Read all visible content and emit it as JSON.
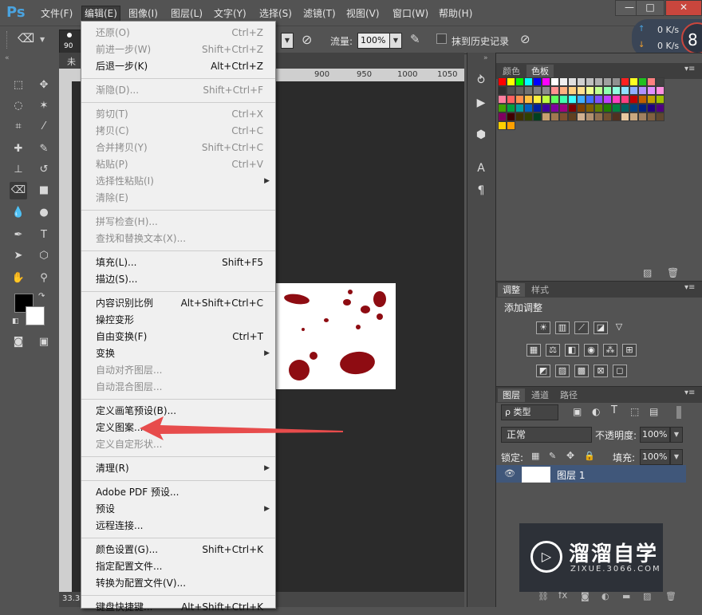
{
  "menubar": {
    "logo": "Ps",
    "items": [
      "文件(F)",
      "编辑(E)",
      "图像(I)",
      "图层(L)",
      "文字(Y)",
      "选择(S)",
      "滤镜(T)",
      "视图(V)",
      "窗口(W)",
      "帮助(H)"
    ],
    "window_buttons": [
      "—",
      "□",
      "✕"
    ]
  },
  "options": {
    "brush_size": "90",
    "flow_label": "流量:",
    "flow_value": "100%",
    "erase_history_label": "抹到历史记录"
  },
  "net": {
    "up": "0 K/s",
    "down": "0 K/s",
    "badge": "8"
  },
  "document": {
    "tab_label": "未",
    "ruler_ticks": [
      "900",
      "950",
      "1000",
      "1050"
    ],
    "zoom": "33.3"
  },
  "edit_menu": {
    "groups": [
      [
        {
          "label": "还原(O)",
          "shortcut": "Ctrl+Z",
          "disabled": true
        },
        {
          "label": "前进一步(W)",
          "shortcut": "Shift+Ctrl+Z",
          "disabled": true
        },
        {
          "label": "后退一步(K)",
          "shortcut": "Alt+Ctrl+Z",
          "disabled": false
        }
      ],
      [
        {
          "label": "渐隐(D)...",
          "shortcut": "Shift+Ctrl+F",
          "disabled": true
        }
      ],
      [
        {
          "label": "剪切(T)",
          "shortcut": "Ctrl+X",
          "disabled": true
        },
        {
          "label": "拷贝(C)",
          "shortcut": "Ctrl+C",
          "disabled": true
        },
        {
          "label": "合并拷贝(Y)",
          "shortcut": "Shift+Ctrl+C",
          "disabled": true
        },
        {
          "label": "粘贴(P)",
          "shortcut": "Ctrl+V",
          "disabled": true
        },
        {
          "label": "选择性粘贴(I)",
          "shortcut": "",
          "disabled": true,
          "submenu": true
        },
        {
          "label": "清除(E)",
          "shortcut": "",
          "disabled": true
        }
      ],
      [
        {
          "label": "拼写检查(H)...",
          "shortcut": "",
          "disabled": true
        },
        {
          "label": "查找和替换文本(X)...",
          "shortcut": "",
          "disabled": true
        }
      ],
      [
        {
          "label": "填充(L)...",
          "shortcut": "Shift+F5",
          "disabled": false
        },
        {
          "label": "描边(S)...",
          "shortcut": "",
          "disabled": false
        }
      ],
      [
        {
          "label": "内容识别比例",
          "shortcut": "Alt+Shift+Ctrl+C",
          "disabled": false
        },
        {
          "label": "操控变形",
          "shortcut": "",
          "disabled": false
        },
        {
          "label": "自由变换(F)",
          "shortcut": "Ctrl+T",
          "disabled": false
        },
        {
          "label": "变换",
          "shortcut": "",
          "disabled": false,
          "submenu": true
        },
        {
          "label": "自动对齐图层...",
          "shortcut": "",
          "disabled": true
        },
        {
          "label": "自动混合图层...",
          "shortcut": "",
          "disabled": true
        }
      ],
      [
        {
          "label": "定义画笔预设(B)...",
          "shortcut": "",
          "disabled": false
        },
        {
          "label": "定义图案...",
          "shortcut": "",
          "disabled": false
        },
        {
          "label": "定义自定形状...",
          "shortcut": "",
          "disabled": true
        }
      ],
      [
        {
          "label": "清理(R)",
          "shortcut": "",
          "disabled": false,
          "submenu": true
        }
      ],
      [
        {
          "label": "Adobe PDF 预设...",
          "shortcut": "",
          "disabled": false
        },
        {
          "label": "预设",
          "shortcut": "",
          "disabled": false,
          "submenu": true
        },
        {
          "label": "远程连接...",
          "shortcut": "",
          "disabled": false
        }
      ],
      [
        {
          "label": "颜色设置(G)...",
          "shortcut": "Shift+Ctrl+K",
          "disabled": false
        },
        {
          "label": "指定配置文件...",
          "shortcut": "",
          "disabled": false
        },
        {
          "label": "转换为配置文件(V)...",
          "shortcut": "",
          "disabled": false
        }
      ],
      [
        {
          "label": "键盘快捷键...",
          "shortcut": "Alt+Shift+Ctrl+K",
          "disabled": false
        }
      ]
    ]
  },
  "panels": {
    "color": {
      "tabs": [
        "颜色",
        "色板"
      ],
      "active": 1
    },
    "adjust": {
      "tabs": [
        "调整",
        "样式"
      ],
      "active": 0,
      "title": "添加调整"
    },
    "layers": {
      "tabs": [
        "图层",
        "通道",
        "路径"
      ],
      "active": 0,
      "filter_label": "ρ 类型",
      "blend_mode": "正常",
      "opacity_label": "不透明度:",
      "opacity": "100%",
      "lock_label": "锁定:",
      "fill_label": "填充:",
      "fill": "100%",
      "layer_name": "图层 1"
    }
  },
  "watermark": {
    "title": "溜溜自学",
    "url": "ZIXUE.3066.COM"
  },
  "colors": {
    "swatches": [
      "#ff0000",
      "#ffff00",
      "#00ff00",
      "#00ffff",
      "#0000ff",
      "#ff00ff",
      "#ffffff",
      "#f0f0f0",
      "#e0e0e0",
      "#d0d0d0",
      "#c0c0c0",
      "#b0b0b0",
      "#a0a0a0",
      "#909090",
      "#ff2020",
      "#ffff20",
      "#20c020",
      "#ff8080",
      "#404040",
      "#303030",
      "#505050",
      "#606060",
      "#707070",
      "#808080",
      "#8c8c8c",
      "#ff9090",
      "#ffb080",
      "#ffd080",
      "#ffe090",
      "#f0ff90",
      "#c0ff90",
      "#90ffb0",
      "#90ffe0",
      "#90e0ff",
      "#90b0ff",
      "#b090ff",
      "#e090ff",
      "#ff90e0",
      "#ff80a0",
      "#ff6060",
      "#ff9050",
      "#ffc040",
      "#fff040",
      "#c0ff40",
      "#60ff60",
      "#40ffb0",
      "#40ffff",
      "#40b0ff",
      "#4070ff",
      "#8050ff",
      "#c040ff",
      "#ff40c0",
      "#ff4080",
      "#c00000",
      "#c06000",
      "#c0a000",
      "#a0c000",
      "#40a000",
      "#00a040",
      "#00a0a0",
      "#0060c0",
      "#0020a0",
      "#4000a0",
      "#8000a0",
      "#a00080",
      "#800000",
      "#804000",
      "#806000",
      "#608000",
      "#208000",
      "#008040",
      "#006060",
      "#004080",
      "#002080",
      "#200080",
      "#500080",
      "#800060",
      "#400000",
      "#403000",
      "#304000",
      "#004020",
      "#c8a070",
      "#a07850",
      "#805030",
      "#604020",
      "#d0b090",
      "#b09070",
      "#907050",
      "#705030",
      "#503020",
      "#e8c8a0",
      "#c8a880",
      "#a08060",
      "#806040",
      "#604830",
      "#ffd000",
      "#ffa000"
    ],
    "menu_arrow": "#e74c4c"
  }
}
